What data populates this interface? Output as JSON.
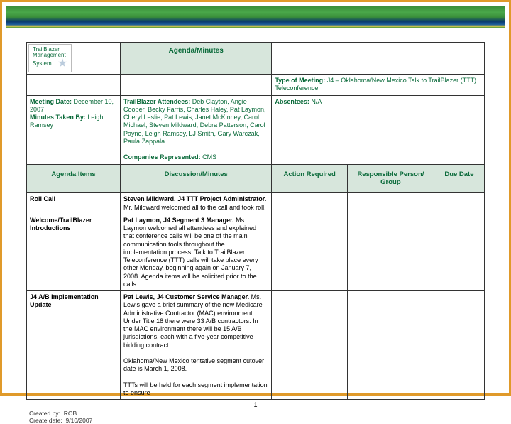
{
  "logo": {
    "line1": "TrailBlazer",
    "line2": "Management",
    "line3": "System",
    "star": "★"
  },
  "header_title": "Agenda/Minutes",
  "meeting_type_label": "Type of Meeting:",
  "meeting_type_value": "J4 – Oklahoma/New Mexico Talk to TrailBlazer (TTT) Teleconference",
  "meeting_date_label": "Meeting Date:",
  "meeting_date_value": "December 10, 2007",
  "minutes_by_label": "Minutes Taken By:",
  "minutes_by_value": "Leigh Ramsey",
  "attendees_label": "TrailBlazer Attendees:",
  "attendees_value": "Deb Clayton, Angie Cooper, Becky Farris, Charles Haley, Pat Laymon, Cheryl Leslie, Pat Lewis, Janet McKinney, Carol Michael, Steven Mildward, Debra Patterson, Carol Payne, Leigh Ramsey, LJ Smith, Gary Warczak, Paula Zappala",
  "companies_label": "Companies Represented:",
  "companies_value": "CMS",
  "absentees_label": "Absentees:",
  "absentees_value": "N/A",
  "columns": {
    "agenda_items": "Agenda Items",
    "discussion": "Discussion/Minutes",
    "action_required": "Action Required",
    "responsible": "Responsible Person/ Group",
    "due_date": "Due Date"
  },
  "rows": [
    {
      "item": "Roll Call",
      "lead": "Steven Mildward, J4 TTT Project Administrator.",
      "text": " Mr. Mildward welcomed all to the call and took roll."
    },
    {
      "item": "Welcome/TrailBlazer Introductions",
      "lead": "Pat Laymon, J4 Segment 3 Manager.",
      "text": " Ms. Laymon welcomed all attendees and explained that conference calls will be one of the main communication tools throughout the implementation process. Talk to TrailBlazer Teleconference (TTT) calls will take place every other Monday, beginning again on January 7, 2008. Agenda items will be solicited prior to the calls."
    },
    {
      "item": "J4 A/B Implementation Update",
      "lead": "Pat Lewis, J4 Customer Service Manager.",
      "text": " Ms. Lewis gave a brief summary of the new Medicare Administrative Contractor (MAC) environment. Under Title 18 there were 33 A/B contractors. In the MAC environment there will be 15 A/B jurisdictions, each with a five-year competitive bidding contract.",
      "text2": "Oklahoma/New Mexico tentative segment cutover date is March 1, 2008.",
      "text3": "TTTs will be held for each segment implementation to ensure"
    }
  ],
  "page_number": "1",
  "footer_created_by_label": "Created by:",
  "footer_created_by_value": "ROB",
  "footer_create_date_label": "Create date:",
  "footer_create_date_value": "9/10/2007"
}
